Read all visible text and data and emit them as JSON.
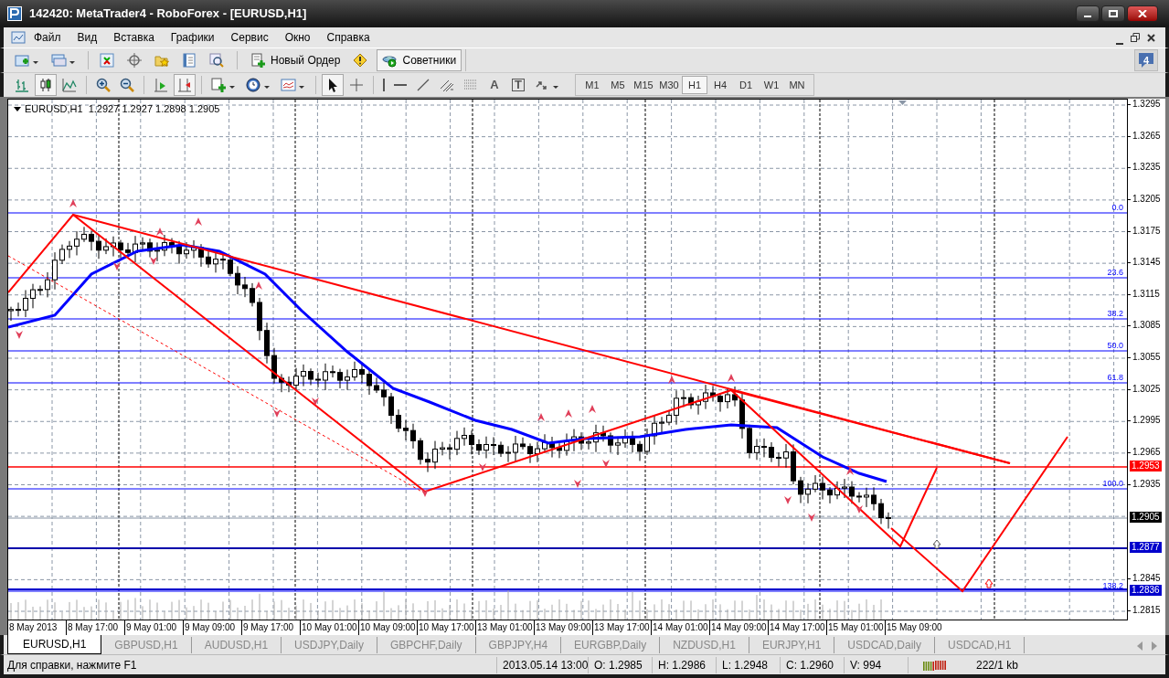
{
  "window": {
    "title": "142420: MetaTrader4 - RoboForex - [EURUSD,H1]"
  },
  "menu": [
    "Файл",
    "Вид",
    "Вставка",
    "Графики",
    "Сервис",
    "Окно",
    "Справка"
  ],
  "toolbar1": [
    {
      "kind": "new-chart"
    },
    {
      "kind": "profiles"
    },
    {
      "kind": "sep"
    },
    {
      "kind": "market-watch"
    },
    {
      "kind": "navigator"
    },
    {
      "kind": "favorites"
    },
    {
      "kind": "terminal"
    },
    {
      "kind": "tester"
    },
    {
      "kind": "sep"
    },
    {
      "kind": "order",
      "label": "Новый Ордер",
      "pressed": false
    },
    {
      "kind": "alert"
    },
    {
      "kind": "experts",
      "label": "Советники",
      "pressed": true
    }
  ],
  "notifications": "4",
  "toolbar2": [
    {
      "kind": "bars",
      "pressed": false
    },
    {
      "kind": "candles",
      "pressed": true
    },
    {
      "kind": "line",
      "pressed": false
    },
    {
      "kind": "sep"
    },
    {
      "kind": "zoom-in",
      "pressed": false
    },
    {
      "kind": "zoom-out",
      "pressed": false
    },
    {
      "kind": "sep"
    },
    {
      "kind": "shift",
      "pressed": false
    },
    {
      "kind": "autoscroll",
      "pressed": true
    },
    {
      "kind": "sep"
    },
    {
      "kind": "indicators",
      "pressed": false
    },
    {
      "kind": "periods",
      "pressed": false
    },
    {
      "kind": "templates",
      "pressed": false
    },
    {
      "kind": "sep"
    },
    {
      "kind": "cursor",
      "pressed": true
    },
    {
      "kind": "crosshair",
      "pressed": false
    },
    {
      "kind": "sep"
    },
    {
      "kind": "vline",
      "pressed": false
    },
    {
      "kind": "hline",
      "pressed": false
    },
    {
      "kind": "trendline",
      "pressed": false
    },
    {
      "kind": "channel",
      "pressed": false
    },
    {
      "kind": "fibo",
      "pressed": false
    },
    {
      "kind": "text",
      "glyph": "A",
      "pressed": false
    },
    {
      "kind": "label",
      "glyph": "T",
      "pressed": false
    },
    {
      "kind": "arrows",
      "pressed": false
    }
  ],
  "timeframes": [
    {
      "label": "M1",
      "selected": false
    },
    {
      "label": "M5",
      "selected": false
    },
    {
      "label": "M15",
      "selected": false
    },
    {
      "label": "M30",
      "selected": false
    },
    {
      "label": "H1",
      "selected": true
    },
    {
      "label": "H4",
      "selected": false
    },
    {
      "label": "D1",
      "selected": false
    },
    {
      "label": "W1",
      "selected": false
    },
    {
      "label": "MN",
      "selected": false
    }
  ],
  "chart": {
    "legend": "EURUSD,H1  1.2927 1.2927 1.2898 1.2905",
    "price_axis": [
      "1.3295",
      "1.3265",
      "1.3235",
      "1.3205",
      "1.3175",
      "1.3145",
      "1.3115",
      "1.3085",
      "1.3055",
      "1.3025",
      "1.2995",
      "1.2965",
      "1.2935",
      "1.2845",
      "1.2815"
    ],
    "fib_levels": [
      "0.0",
      "23.6",
      "38.2",
      "50.0",
      "61.8",
      "100.0",
      "138.2"
    ],
    "price_markers": [
      {
        "text": "1.2953",
        "color": "#ff0000"
      },
      {
        "text": "1.2905",
        "color": "#000000"
      },
      {
        "text": "1.2877",
        "color": "#0000cc"
      },
      {
        "text": "1.2836",
        "color": "#0000cc"
      }
    ],
    "time_axis": [
      "8 May 2013",
      "8 May 17:00",
      "9 May 01:00",
      "9 May 09:00",
      "9 May 17:00",
      "10 May 01:00",
      "10 May 09:00",
      "10 May 17:00",
      "13 May 01:00",
      "13 May 09:00",
      "13 May 17:00",
      "14 May 01:00",
      "14 May 09:00",
      "14 May 17:00",
      "15 May 01:00",
      "15 May 09:00"
    ]
  },
  "tabs": [
    {
      "label": "EURUSD,H1",
      "selected": true
    },
    {
      "label": "GBPUSD,H1",
      "selected": false
    },
    {
      "label": "AUDUSD,H1",
      "selected": false
    },
    {
      "label": "USDJPY,Daily",
      "selected": false
    },
    {
      "label": "GBPCHF,Daily",
      "selected": false
    },
    {
      "label": "GBPJPY,H4",
      "selected": false
    },
    {
      "label": "EURGBP,Daily",
      "selected": false
    },
    {
      "label": "NZDUSD,H1",
      "selected": false
    },
    {
      "label": "EURJPY,H1",
      "selected": false
    },
    {
      "label": "USDCAD,Daily",
      "selected": false
    },
    {
      "label": "USDCAD,H1",
      "selected": false
    }
  ],
  "status_bar": {
    "help": "Для справки, нажмите F1",
    "fields": [
      "2013.05.14 13:00",
      "O: 1.2985",
      "H: 1.2986",
      "L: 1.2948",
      "C: 1.2960",
      "V: 994"
    ],
    "traffic": "222/1 kb"
  }
}
